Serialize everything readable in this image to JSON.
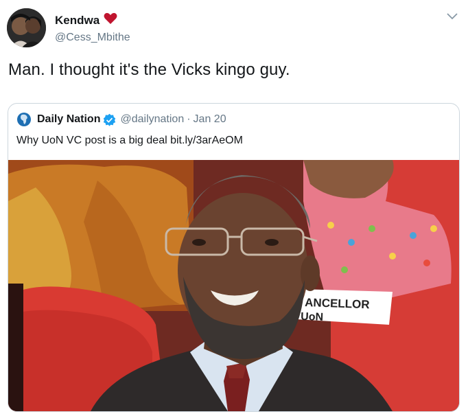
{
  "tweet": {
    "display_name": "Kendwa",
    "handle": "@Cess_Mbithe",
    "text": "Man. I thought it's the Vicks kingo guy."
  },
  "quoted": {
    "display_name": "Daily Nation",
    "handle": "@dailynation",
    "separator": "·",
    "date": "Jan 20",
    "text": "Why UoN VC post is a big deal bit.ly/3arAeOM",
    "photo_sign_line1": "ANCELLOR",
    "photo_sign_line2": "UoN"
  },
  "icons": {
    "heart": "heart-icon",
    "menu": "chevron-down-icon",
    "logo": "daily-nation-logo",
    "verified": "verified-badge-icon"
  },
  "colors": {
    "heart": "#c0152f",
    "verified": "#1da1f2",
    "secondary_text": "#657786",
    "quote_border": "#ccd6dd"
  }
}
